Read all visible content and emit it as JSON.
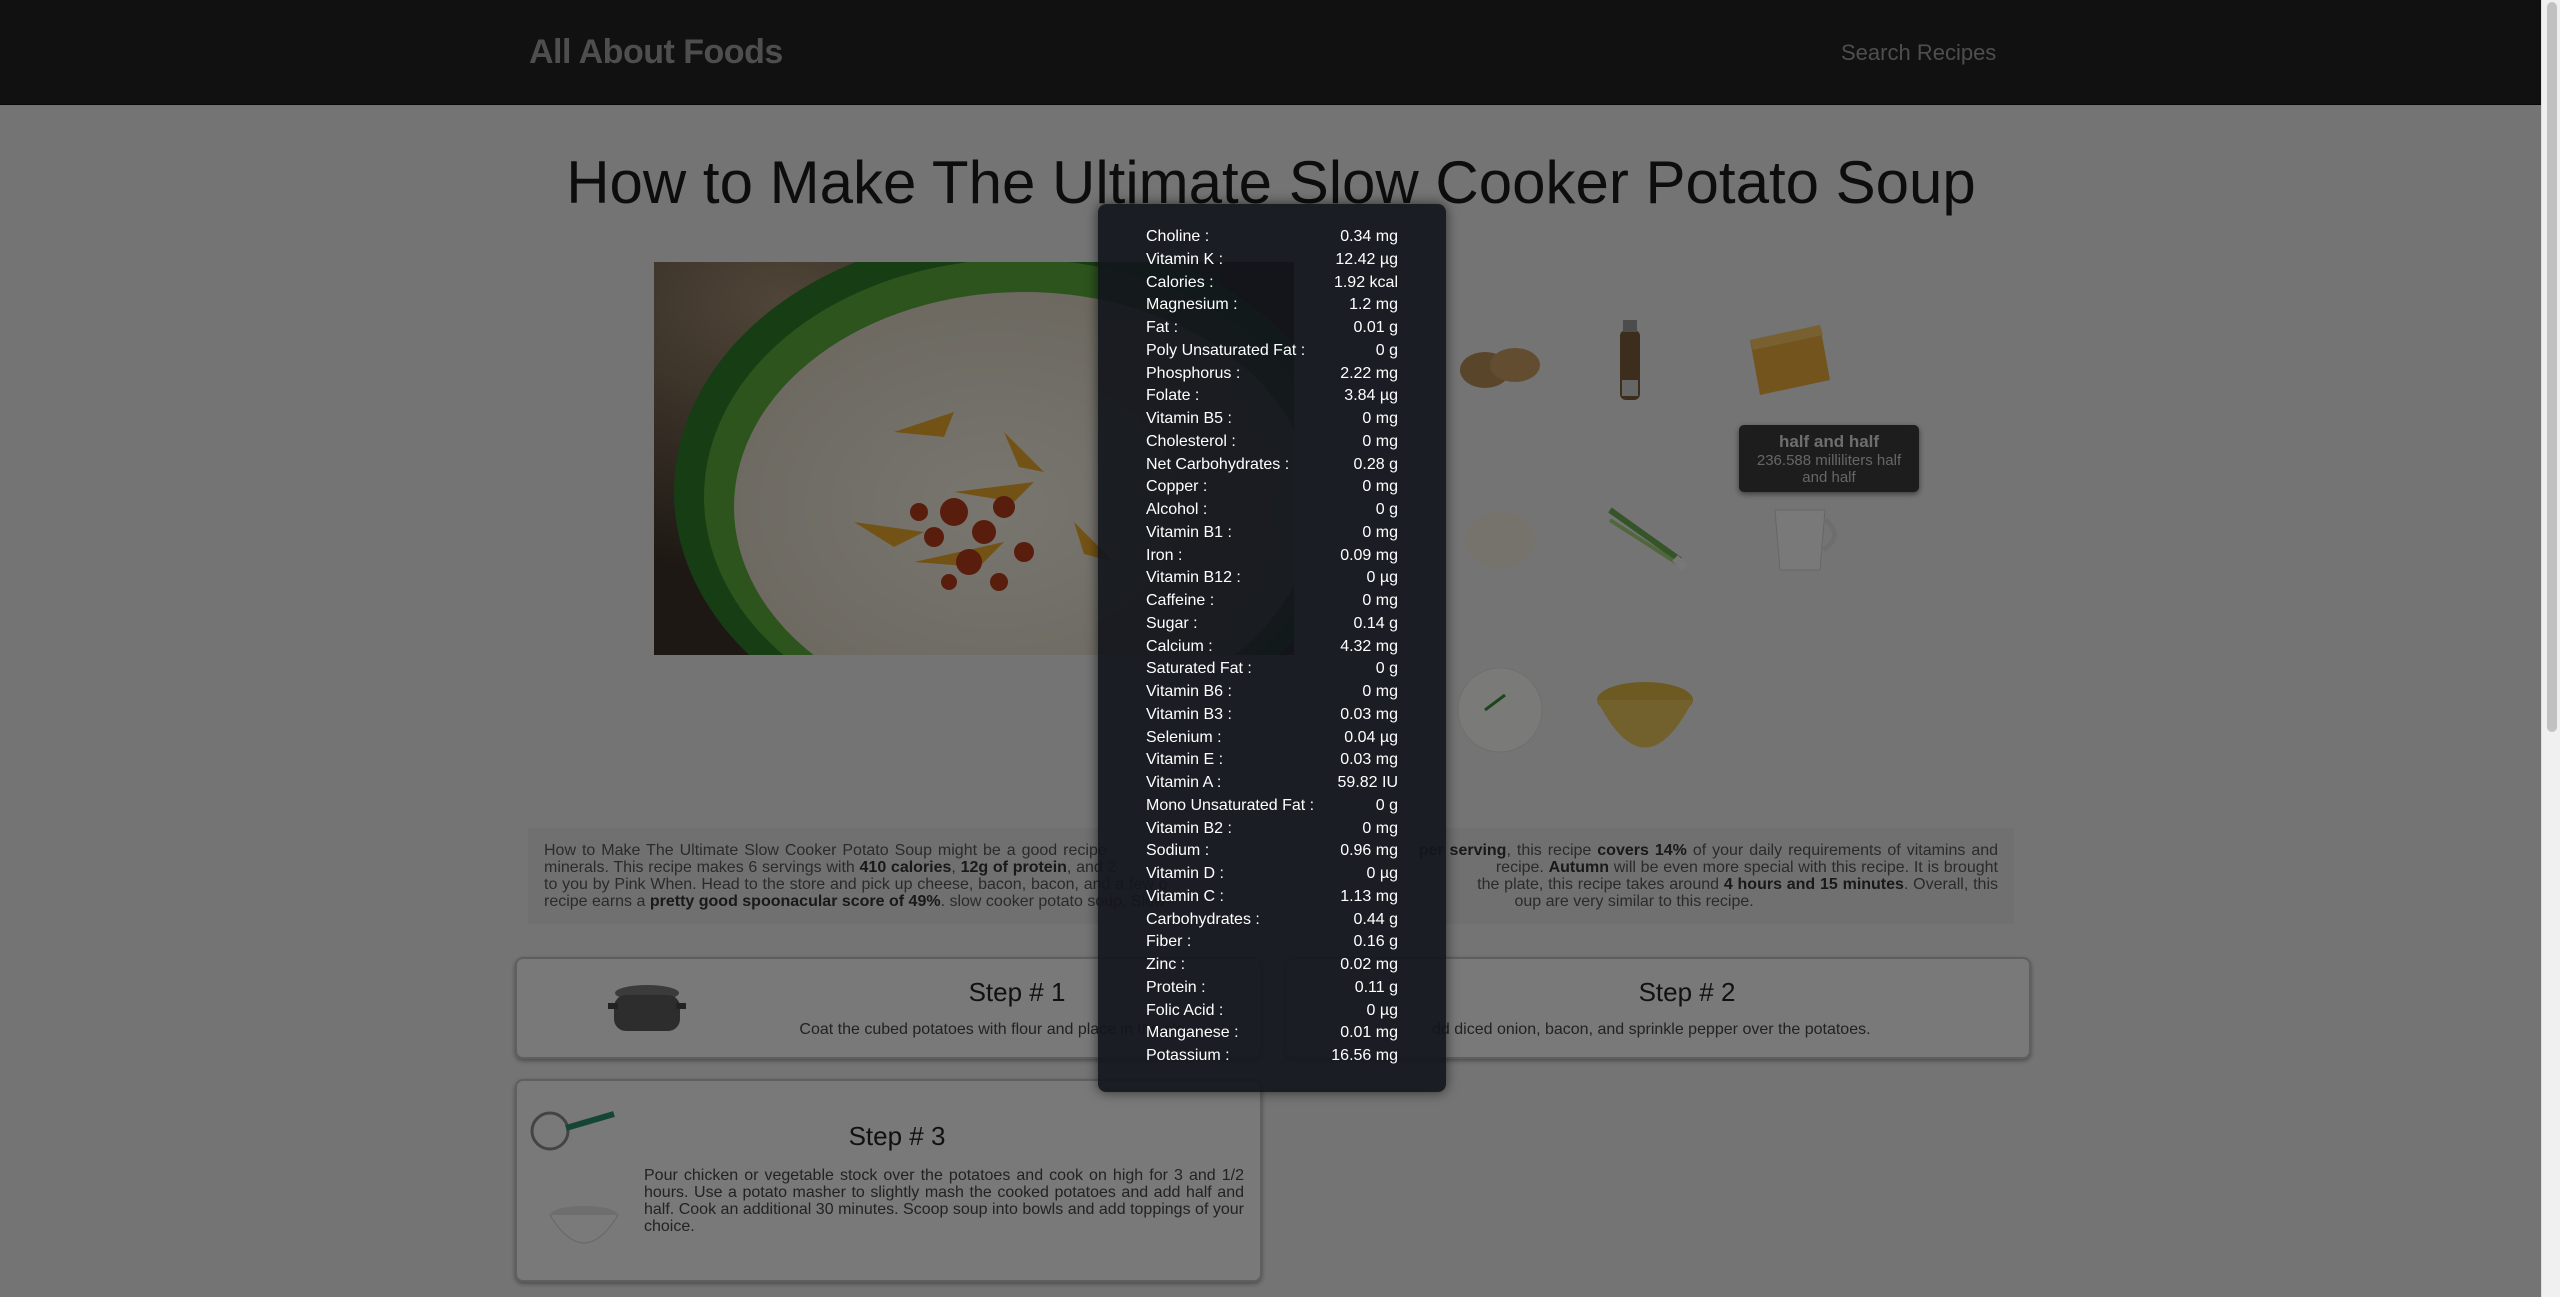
{
  "nav": {
    "brand": "All About Foods",
    "search": "Search Recipes"
  },
  "recipe": {
    "title": "How to Make The Ultimate Slow Cooker Potato Soup"
  },
  "ingredient_tooltip": {
    "name": "half and half",
    "amount": "236.588 milliliters half and half"
  },
  "ingredients_icons": [
    "potatoes-icon",
    "pepper-mill-icon",
    "cheese-icon",
    "flour-icon",
    "green-onion-icon",
    "cream-pitcher-icon",
    "sour-cream-icon",
    "broth-icon"
  ],
  "summary": {
    "s1": "How to Make The Ultimate Slow Cooker Potato Soup might be a good recipe",
    "s2": "per serving",
    "s3": ", this recipe",
    "s4": "covers 14%",
    "s5": "of your daily requirements of vitamins and minerals. This recipe makes 6 servings with",
    "s6": "410 calories",
    "s7": ", ",
    "s8": "12g of protein",
    "s9": ", and 2",
    "s10": "recipe.",
    "s11": "Autumn",
    "s12": "will be even more special with this recipe. It is brought to you by Pink When. Head to the store and pick up cheese, bacon, bacon, and a few o",
    "s13": "the plate, this recipe takes around",
    "s14": "4 hours and 15 minutes",
    "s15": ". Overall, this recipe earns a",
    "s16": "pretty good spoonacular score of 49%",
    "s17": ". slow cooker potato soup, Slow",
    "s18": "oup are very similar to this recipe."
  },
  "steps": [
    {
      "title": "Step # 1",
      "text": "Coat the cubed potatoes with flour and place in the slo"
    },
    {
      "title": "Step # 2",
      "text": "dd diced onion, bacon, and sprinkle pepper over the potatoes."
    },
    {
      "title": "Step # 3",
      "text": "Pour chicken or vegetable stock over the potatoes and cook on high for 3 and 1/2 hours. Use a potato masher to slightly mash the cooked potatoes and add half and half. Cook an additional 30 minutes. Scoop soup into bowls and add toppings of your choice."
    }
  ],
  "nutrition": [
    {
      "name": "Choline :",
      "value": "0.34 mg"
    },
    {
      "name": "Vitamin K :",
      "value": "12.42 µg"
    },
    {
      "name": "Calories :",
      "value": "1.92 kcal"
    },
    {
      "name": "Magnesium :",
      "value": "1.2 mg"
    },
    {
      "name": "Fat :",
      "value": "0.01 g"
    },
    {
      "name": "Poly Unsaturated Fat :",
      "value": "0 g"
    },
    {
      "name": "Phosphorus :",
      "value": "2.22 mg"
    },
    {
      "name": "Folate :",
      "value": "3.84 µg"
    },
    {
      "name": "Vitamin B5 :",
      "value": "0 mg"
    },
    {
      "name": "Cholesterol :",
      "value": "0 mg"
    },
    {
      "name": "Net Carbohydrates :",
      "value": "0.28 g"
    },
    {
      "name": "Copper :",
      "value": "0 mg"
    },
    {
      "name": "Alcohol :",
      "value": "0 g"
    },
    {
      "name": "Vitamin B1 :",
      "value": "0 mg"
    },
    {
      "name": "Iron :",
      "value": "0.09 mg"
    },
    {
      "name": "Vitamin B12 :",
      "value": "0 µg"
    },
    {
      "name": "Caffeine :",
      "value": "0 mg"
    },
    {
      "name": "Sugar :",
      "value": "0.14 g"
    },
    {
      "name": "Calcium :",
      "value": "4.32 mg"
    },
    {
      "name": "Saturated Fat :",
      "value": "0 g"
    },
    {
      "name": "Vitamin B6 :",
      "value": "0 mg"
    },
    {
      "name": "Vitamin B3 :",
      "value": "0.03 mg"
    },
    {
      "name": "Selenium :",
      "value": "0.04 µg"
    },
    {
      "name": "Vitamin E :",
      "value": "0.03 mg"
    },
    {
      "name": "Vitamin A :",
      "value": "59.82 IU"
    },
    {
      "name": "Mono Unsaturated Fat :",
      "value": "0 g"
    },
    {
      "name": "Vitamin B2 :",
      "value": "0 mg"
    },
    {
      "name": "Sodium :",
      "value": "0.96 mg"
    },
    {
      "name": "Vitamin D :",
      "value": "0 µg"
    },
    {
      "name": "Vitamin C :",
      "value": "1.13 mg"
    },
    {
      "name": "Carbohydrates :",
      "value": "0.44 g"
    },
    {
      "name": "Fiber :",
      "value": "0.16 g"
    },
    {
      "name": "Zinc :",
      "value": "0.02 mg"
    },
    {
      "name": "Protein :",
      "value": "0.11 g"
    },
    {
      "name": "Folic Acid :",
      "value": "0 µg"
    },
    {
      "name": "Manganese :",
      "value": "0.01 mg"
    },
    {
      "name": "Potassium :",
      "value": "16.56 mg"
    }
  ]
}
